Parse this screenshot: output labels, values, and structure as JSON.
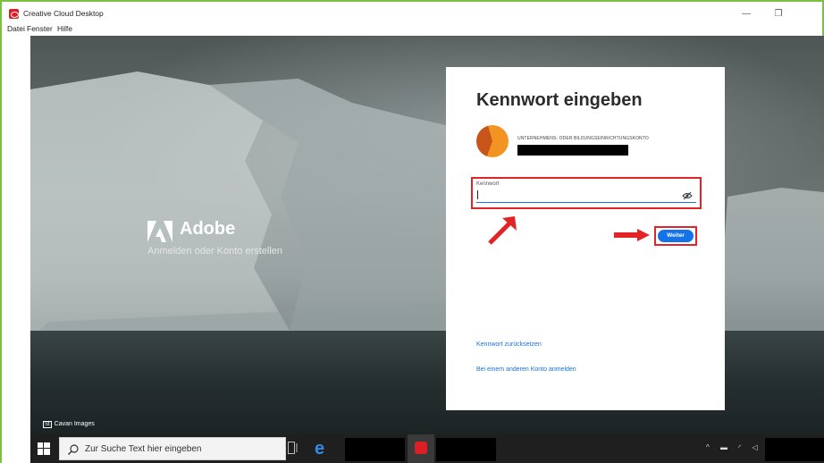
{
  "window": {
    "title": "Creative Cloud Desktop",
    "controls": {
      "minimize": "—",
      "restore": "❐"
    }
  },
  "menu": {
    "items": [
      "Datei",
      "Fenster",
      "Hilfe"
    ]
  },
  "brand": {
    "name": "Adobe",
    "tagline": "Anmelden oder Konto erstellen"
  },
  "photo_credit": {
    "badge": "St",
    "text": "Cavan Images"
  },
  "login": {
    "title": "Kennwort eingeben",
    "account_type": "UNTERNEHMENS- ODER BILDUNGSEINRICHTUNGSKONTO",
    "password_label": "Kennwort",
    "password_value": "",
    "continue_label": "Weiter",
    "reset_link": "Kennwort zurücksetzen",
    "other_account_link": "Bei einem anderen Konto anmelden"
  },
  "taskbar": {
    "search_placeholder": "Zur Suche Text hier eingeben",
    "edge_glyph": "e",
    "tray": "^ ▬ ◜ ◁"
  },
  "colors": {
    "accent": "#1473e6",
    "annotation_red": "#e32325",
    "frame_green": "#7ac142",
    "adobe_red": "#da1f26"
  }
}
